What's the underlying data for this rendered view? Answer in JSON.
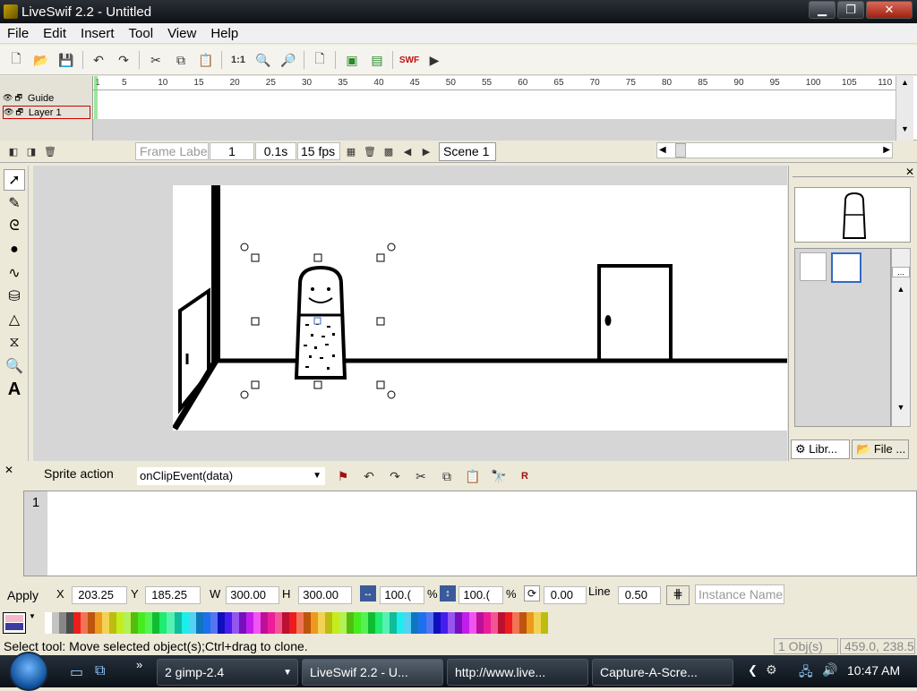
{
  "window": {
    "title": "LiveSwif 2.2 - Untitled",
    "min": "▁",
    "max": "❐",
    "close": "✕"
  },
  "menu": [
    "File",
    "Edit",
    "Insert",
    "Tool",
    "View",
    "Help"
  ],
  "toolbar": {
    "zoom": "1:1"
  },
  "timeline": {
    "layers": [
      {
        "name": "Guide"
      },
      {
        "name": "Layer 1"
      }
    ],
    "ruler": [
      "1",
      "5",
      "10",
      "15",
      "20",
      "25",
      "30",
      "35",
      "40",
      "45",
      "50",
      "55",
      "60",
      "65",
      "70",
      "75",
      "80",
      "85",
      "90",
      "95",
      "100",
      "105",
      "110"
    ]
  },
  "framebar": {
    "frame_label_placeholder": "Frame Labe",
    "frame": "1",
    "time": "0.1s",
    "fps": "15 fps",
    "scene": "Scene 1"
  },
  "library": {
    "tab_library": "Libr...",
    "tab_file": "File ...",
    "scroll_btn": "..."
  },
  "actions": {
    "title": "Sprite action",
    "event": "onClipEvent(data)",
    "line_no": "1"
  },
  "properties": {
    "apply": "Apply",
    "x_label": "X",
    "x": "203.25",
    "y_label": "Y",
    "y": "185.25",
    "w_label": "W",
    "w": "300.00",
    "h_label": "H",
    "h": "300.00",
    "scale_x": "100.(",
    "pct1": "%",
    "scale_y": "100.(",
    "pct2": "%",
    "rotation": "0.00",
    "line_label": "Line",
    "line": "0.50",
    "instance_placeholder": "Instance Name"
  },
  "status": {
    "message": "Select tool: Move selected object(s);Ctrl+drag to clone.",
    "objects": "1 Obj(s)",
    "coords": "459.0, 238.5"
  },
  "taskbar": {
    "tasks": [
      {
        "label": "2  gimp-2.4"
      },
      {
        "label": "LiveSwif 2.2 - U..."
      },
      {
        "label": "http://www.live..."
      },
      {
        "label": "Capture-A-Scre..."
      }
    ],
    "clock": "10:47 AM",
    "more": "»"
  },
  "colors": {
    "accent": "#316ac5",
    "selection": "#d00000"
  }
}
